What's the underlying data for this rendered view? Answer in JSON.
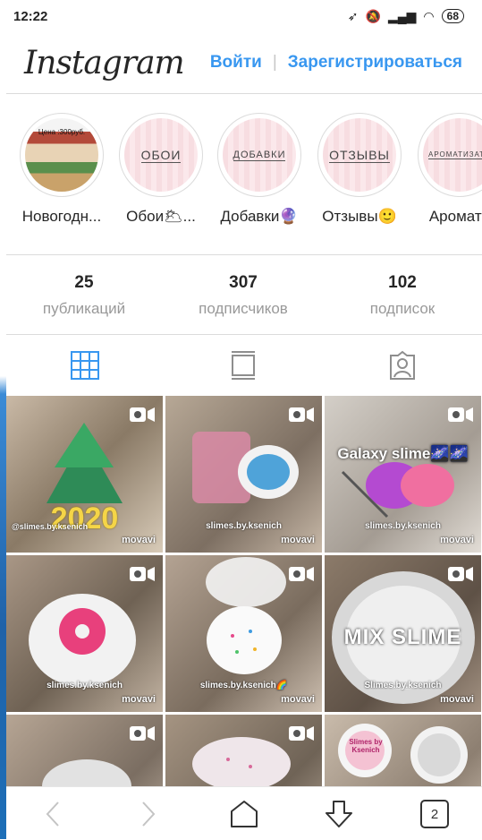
{
  "status_bar": {
    "time": "12:22",
    "battery": "68"
  },
  "header": {
    "logo": "Instagram",
    "login": "Войти",
    "signup": "Зарегистрироваться"
  },
  "highlights": [
    {
      "label": "Новогодн...",
      "cover_text": "Цена :300руб."
    },
    {
      "label": "Обои🌥...",
      "cover_text": "ОБОИ"
    },
    {
      "label": "Добавки🔮",
      "cover_text": "ДОБАВКИ"
    },
    {
      "label": "Отзывы🙂",
      "cover_text": "ОТЗЫВЫ"
    },
    {
      "label": "Аромати",
      "cover_text": "АРОМАТИЗАТО"
    }
  ],
  "stats": [
    {
      "value": "25",
      "label": "публикаций"
    },
    {
      "value": "307",
      "label": "подписчиков"
    },
    {
      "value": "102",
      "label": "подписок"
    }
  ],
  "tabs": {
    "active_color": "#3897f0",
    "inactive_color": "#8e8e8e"
  },
  "posts": [
    {
      "caption": "@slimes.by.ksenich",
      "brand": "movavi",
      "overlay_text": "2020"
    },
    {
      "caption": "slimes.by.ksenich",
      "brand": "movavi"
    },
    {
      "caption": "slimes.by.ksenich",
      "brand": "movavi",
      "overlay_text": "Galaxy slime🌌🌌"
    },
    {
      "caption": "slimes.by.ksenich",
      "brand": "movavi"
    },
    {
      "caption": "slimes.by.ksenich🌈",
      "brand": "movavi"
    },
    {
      "caption": "Slimes.by.ksenich",
      "brand": "movavi",
      "overlay_text": "MIX SLIME"
    },
    {
      "caption": "",
      "brand": ""
    },
    {
      "caption": "",
      "brand": ""
    },
    {
      "caption": "",
      "brand": "",
      "overlay_text": "Slimes by Ksenich"
    }
  ],
  "bottom_nav": {
    "tabs_count": "2"
  },
  "colors": {
    "link": "#3897f0",
    "border": "#dbdbdb"
  }
}
